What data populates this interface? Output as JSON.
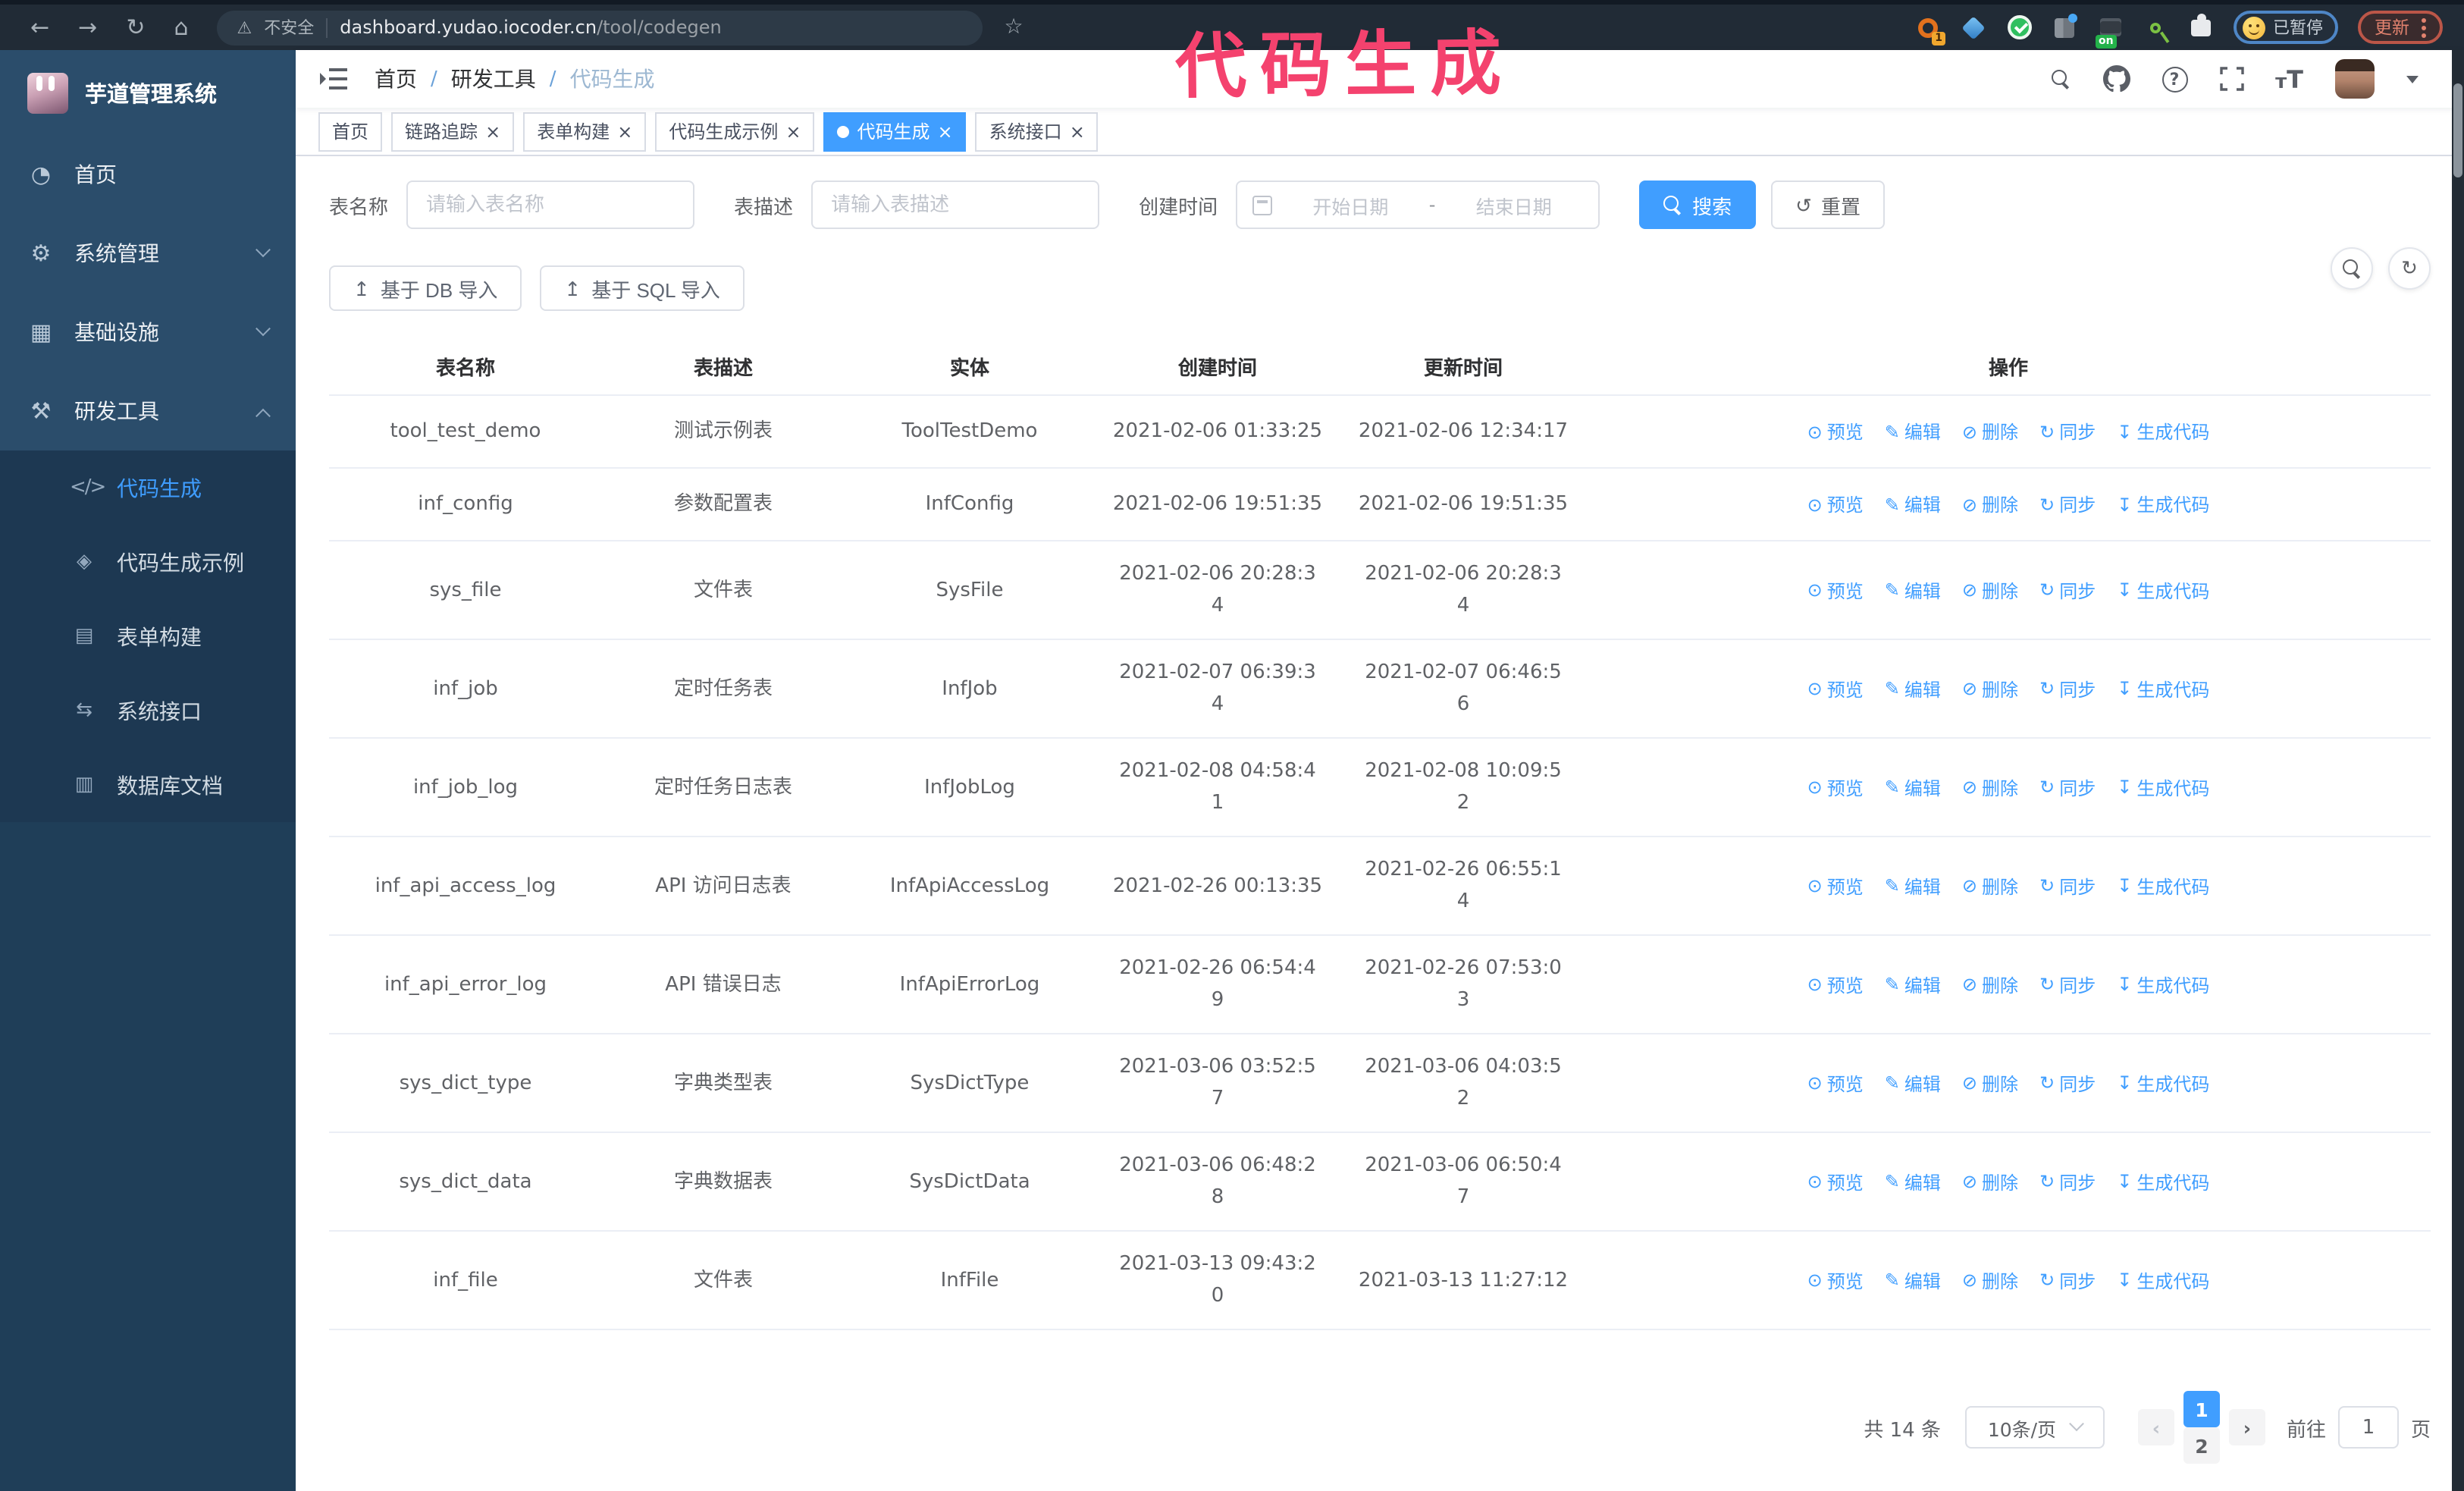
{
  "browser": {
    "security_warning": "不安全",
    "url_host": "dashboard.yudao.iocoder.cn",
    "url_path": "/tool/codegen",
    "extension_badge": "1",
    "extension_on_badge": "on",
    "paused_badge": "已暂停",
    "update_badge": "更新"
  },
  "annotation": {
    "text": "代码生成",
    "color": "#f4426e"
  },
  "sidebar": {
    "logo_title": "芋道管理系统",
    "items": [
      {
        "label": "首页",
        "icon": "dashboard-icon",
        "chevron": "none"
      },
      {
        "label": "系统管理",
        "icon": "gear-icon",
        "chevron": "down"
      },
      {
        "label": "基础设施",
        "icon": "monitor-icon",
        "chevron": "down"
      },
      {
        "label": "研发工具",
        "icon": "toolbox-icon",
        "chevron": "up"
      }
    ],
    "subitems": [
      {
        "label": "代码生成",
        "icon": "code-icon",
        "active": true
      },
      {
        "label": "代码生成示例",
        "icon": "example-icon",
        "active": false
      },
      {
        "label": "表单构建",
        "icon": "form-icon",
        "active": false
      },
      {
        "label": "系统接口",
        "icon": "api-icon",
        "active": false
      },
      {
        "label": "数据库文档",
        "icon": "database-icon",
        "active": false
      }
    ]
  },
  "breadcrumb": {
    "items": [
      "首页",
      "研发工具",
      "代码生成"
    ]
  },
  "tabs": [
    {
      "label": "首页",
      "closable": false,
      "active": false
    },
    {
      "label": "链路追踪",
      "closable": true,
      "active": false
    },
    {
      "label": "表单构建",
      "closable": true,
      "active": false
    },
    {
      "label": "代码生成示例",
      "closable": true,
      "active": false
    },
    {
      "label": "代码生成",
      "closable": true,
      "active": true
    },
    {
      "label": "系统接口",
      "closable": true,
      "active": false
    }
  ],
  "search": {
    "name_label": "表名称",
    "name_placeholder": "请输入表名称",
    "desc_label": "表描述",
    "desc_placeholder": "请输入表描述",
    "time_label": "创建时间",
    "start_placeholder": "开始日期",
    "range_separator": "-",
    "end_placeholder": "结束日期",
    "search_button": "搜索",
    "reset_button": "重置"
  },
  "toolbar": {
    "import_db": "基于 DB 导入",
    "import_sql": "基于 SQL 导入"
  },
  "table": {
    "columns": [
      "表名称",
      "表描述",
      "实体",
      "创建时间",
      "更新时间",
      "操作"
    ],
    "actions": [
      {
        "label": "预览",
        "icon": "eye-icon"
      },
      {
        "label": "编辑",
        "icon": "edit-icon"
      },
      {
        "label": "删除",
        "icon": "trash-icon"
      },
      {
        "label": "同步",
        "icon": "sync-icon"
      },
      {
        "label": "生成代码",
        "icon": "download-icon"
      }
    ],
    "rows": [
      {
        "name": "tool_test_demo",
        "desc": "测试示例表",
        "entity": "ToolTestDemo",
        "created": "2021-02-06 01:33:25",
        "updated": "2021-02-06 12:34:17"
      },
      {
        "name": "inf_config",
        "desc": "参数配置表",
        "entity": "InfConfig",
        "created": "2021-02-06 19:51:35",
        "updated": "2021-02-06 19:51:35"
      },
      {
        "name": "sys_file",
        "desc": "文件表",
        "entity": "SysFile",
        "created": "2021-02-06 20:28:3\n4",
        "updated": "2021-02-06 20:28:3\n4"
      },
      {
        "name": "inf_job",
        "desc": "定时任务表",
        "entity": "InfJob",
        "created": "2021-02-07 06:39:3\n4",
        "updated": "2021-02-07 06:46:5\n6"
      },
      {
        "name": "inf_job_log",
        "desc": "定时任务日志表",
        "entity": "InfJobLog",
        "created": "2021-02-08 04:58:4\n1",
        "updated": "2021-02-08 10:09:5\n2"
      },
      {
        "name": "inf_api_access_log",
        "desc": "API 访问日志表",
        "entity": "InfApiAccessLog",
        "created": "2021-02-26 00:13:35",
        "updated": "2021-02-26 06:55:1\n4"
      },
      {
        "name": "inf_api_error_log",
        "desc": "API 错误日志",
        "entity": "InfApiErrorLog",
        "created": "2021-02-26 06:54:4\n9",
        "updated": "2021-02-26 07:53:0\n3"
      },
      {
        "name": "sys_dict_type",
        "desc": "字典类型表",
        "entity": "SysDictType",
        "created": "2021-03-06 03:52:5\n7",
        "updated": "2021-03-06 04:03:5\n2"
      },
      {
        "name": "sys_dict_data",
        "desc": "字典数据表",
        "entity": "SysDictData",
        "created": "2021-03-06 06:48:2\n8",
        "updated": "2021-03-06 06:50:4\n7"
      },
      {
        "name": "inf_file",
        "desc": "文件表",
        "entity": "InfFile",
        "created": "2021-03-13 09:43:2\n0",
        "updated": "2021-03-13 11:27:12"
      }
    ]
  },
  "pagination": {
    "total_text": "共 14 条",
    "page_size": "10条/页",
    "pages": [
      "1",
      "2"
    ],
    "active_page": "1",
    "goto_label": "前往",
    "goto_value": "1",
    "goto_unit": "页"
  }
}
